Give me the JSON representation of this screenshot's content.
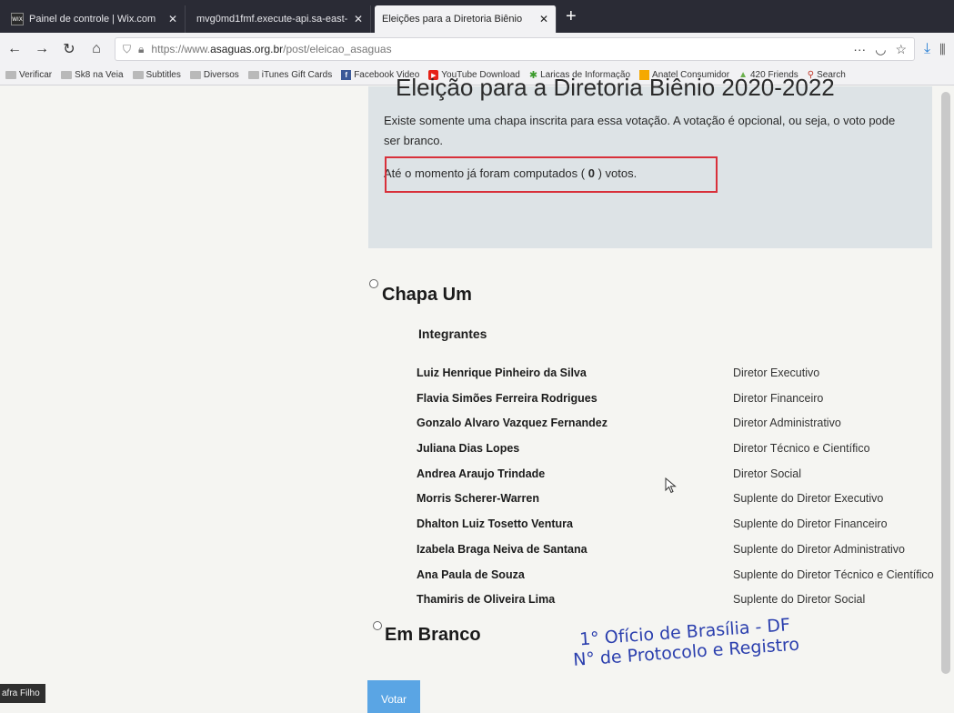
{
  "browser": {
    "tabs": [
      {
        "title": "Painel de controle | Wix.com",
        "favicon": "wix-icon",
        "active": false
      },
      {
        "title": "mvg0md1fmf.execute-api.sa-east-",
        "favicon": "",
        "active": false
      },
      {
        "title": "Eleições para a Diretoria Biênio",
        "favicon": "",
        "active": true
      }
    ],
    "new_tab_label": "+",
    "url_prefix": "https://www.",
    "url_host": "asaguas.org.br",
    "url_path": "/post/eleicao_asaguas",
    "toolbar_more": "···",
    "bookmarks": [
      {
        "label": "Verificar",
        "icon": "folder-icon"
      },
      {
        "label": "Sk8 na Veia",
        "icon": "folder-icon"
      },
      {
        "label": "Subtitles",
        "icon": "folder-icon"
      },
      {
        "label": "Diversos",
        "icon": "folder-icon"
      },
      {
        "label": "iTunes Gift Cards",
        "icon": "folder-icon"
      },
      {
        "label": "Facebook Video",
        "icon": "facebook-icon"
      },
      {
        "label": "YouTube Download",
        "icon": "youtube-icon"
      },
      {
        "label": "Laricas de Informação",
        "icon": "leaf-icon"
      },
      {
        "label": "Anatel Consumidor",
        "icon": "anatel-icon"
      },
      {
        "label": "420 Friends",
        "icon": "friends-icon"
      },
      {
        "label": "Search",
        "icon": "search-icon"
      }
    ]
  },
  "election": {
    "title": "Eleição para a Diretoria Biênio 2020-2022",
    "description": "Existe somente uma chapa inscrita para essa votação. A votação é opcional, ou seja, o voto pode ser branco.",
    "count_prefix": "Até o momento já foram computados (",
    "count_value": "0",
    "count_suffix": ") votos."
  },
  "options": {
    "chapa_label": "Chapa Um",
    "members_heading": "Integrantes",
    "members": [
      {
        "name": "Luiz Henrique Pinheiro da Silva",
        "role": "Diretor Executivo"
      },
      {
        "name": "Flavia Simões Ferreira Rodrigues",
        "role": "Diretor Financeiro"
      },
      {
        "name": "Gonzalo Alvaro Vazquez Fernandez",
        "role": "Diretor Administrativo"
      },
      {
        "name": "Juliana Dias Lopes",
        "role": "Diretor Técnico e Científico"
      },
      {
        "name": "Andrea Araujo Trindade",
        "role": "Diretor Social"
      },
      {
        "name": "Morris Scherer-Warren",
        "role": "Suplente do Diretor Executivo"
      },
      {
        "name": "Dhalton Luiz Tosetto Ventura",
        "role": "Suplente do Diretor Financeiro"
      },
      {
        "name": "Izabela Braga Neiva de Santana",
        "role": "Suplente do Diretor Administrativo"
      },
      {
        "name": "Ana Paula de Souza",
        "role": "Suplente do Diretor Técnico e Científico"
      },
      {
        "name": "Thamiris de Oliveira Lima",
        "role": "Suplente do Diretor Social"
      }
    ],
    "blank_label": "Em Branco"
  },
  "vote_button_label": "Votar",
  "stamp": {
    "line1": "1° Ofício de Brasília - DF",
    "line2": "N° de Protocolo e Registro"
  },
  "footer_label": "afra Filho",
  "colors": {
    "highlight_border": "#d8303a",
    "vote_button": "#5aa5e4",
    "stamp": "#2b3fae"
  }
}
